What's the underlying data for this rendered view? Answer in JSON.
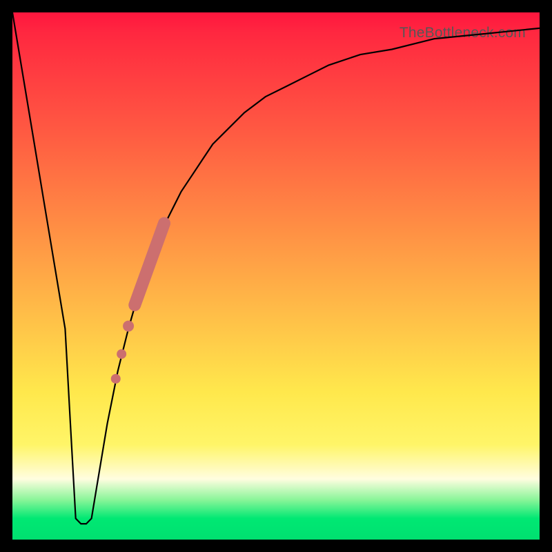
{
  "watermark": "TheBottleneck.com",
  "colors": {
    "frame": "#000000",
    "curve": "#000000",
    "marker": "#cc6f6f",
    "gradient_stops": [
      "#ff163e",
      "#ff5842",
      "#ff8c44",
      "#ffc048",
      "#ffe84c",
      "#fffde0",
      "#00e873"
    ]
  },
  "chart_data": {
    "type": "line",
    "title": "",
    "xlabel": "",
    "ylabel": "",
    "xlim": [
      0,
      100
    ],
    "ylim": [
      0,
      100
    ],
    "grid": false,
    "legend": false,
    "series": [
      {
        "name": "bottleneck-curve",
        "x": [
          0,
          2,
          4,
          6,
          8,
          10,
          11,
          12,
          13,
          14,
          15,
          16,
          18,
          20,
          22,
          24,
          26,
          28,
          30,
          32,
          34,
          36,
          38,
          40,
          44,
          48,
          52,
          56,
          60,
          66,
          72,
          80,
          90,
          100
        ],
        "y": [
          100,
          88,
          76,
          64,
          52,
          40,
          22,
          4,
          3,
          3,
          4,
          10,
          22,
          32,
          40,
          47,
          53,
          58,
          62,
          66,
          69,
          72,
          75,
          77,
          81,
          84,
          86,
          88,
          90,
          92,
          93,
          95,
          96,
          97
        ]
      }
    ],
    "markers": [
      {
        "name": "band-start",
        "x": 23.2,
        "y": 44.5,
        "r": 9
      },
      {
        "name": "band-end",
        "x": 28.8,
        "y": 60.0,
        "r": 9
      },
      {
        "name": "dot-1",
        "x": 22.0,
        "y": 40.5,
        "r": 8
      },
      {
        "name": "dot-2",
        "x": 20.7,
        "y": 35.2,
        "r": 7
      },
      {
        "name": "dot-3",
        "x": 19.6,
        "y": 30.5,
        "r": 7
      }
    ]
  }
}
